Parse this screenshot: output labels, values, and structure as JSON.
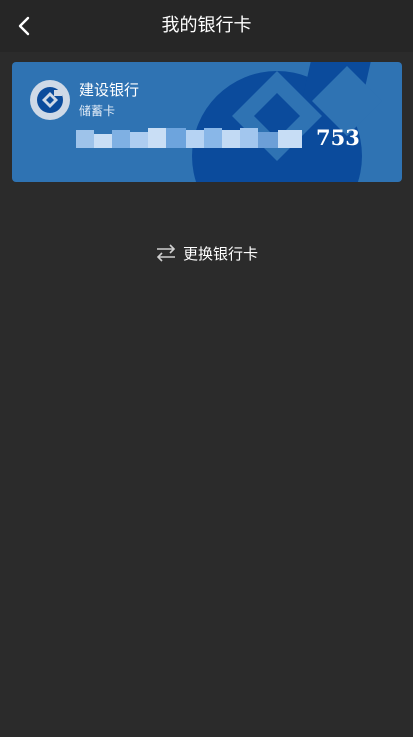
{
  "header": {
    "title": "我的银行卡",
    "back_icon": "chevron-left-icon"
  },
  "card": {
    "bank_name": "建设银行",
    "card_type": "储蓄卡",
    "number_tail": "753",
    "logo_icon": "ccb-logo-icon",
    "background_color": "#2f73b3",
    "watermark_color": "#0b4b9c"
  },
  "actions": {
    "switch_label": "更换银行卡",
    "switch_icon": "swap-arrows-icon"
  }
}
